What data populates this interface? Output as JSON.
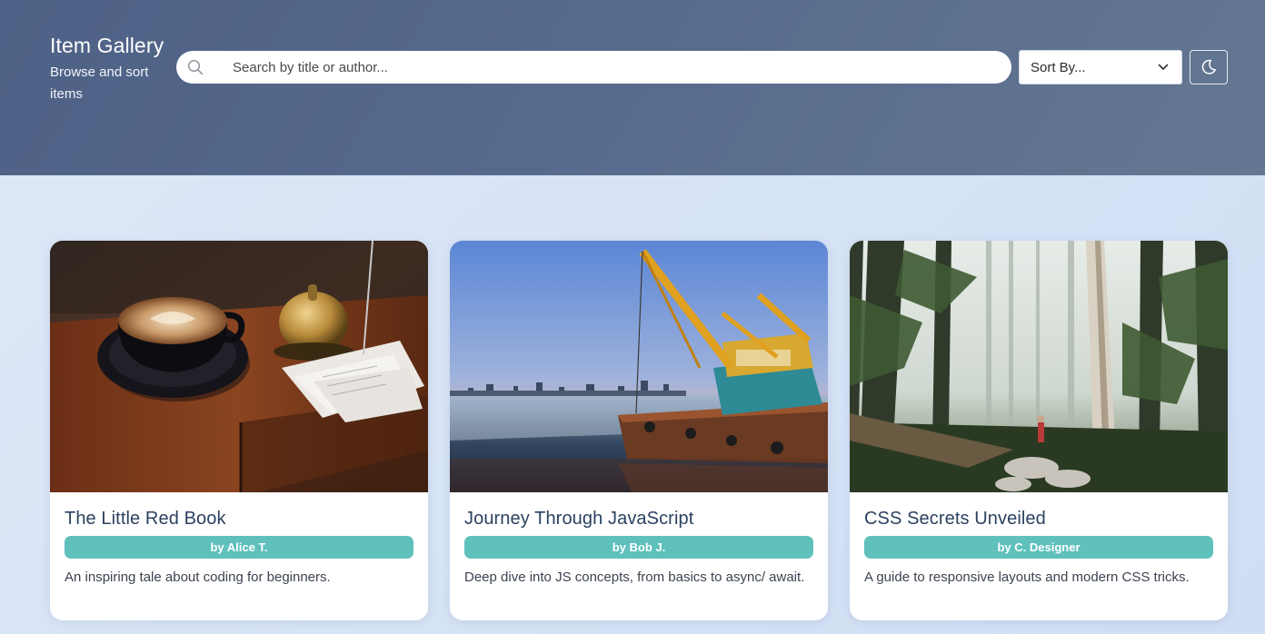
{
  "header": {
    "title": "Item Gallery",
    "subtitle": "Browse and sort items"
  },
  "search": {
    "placeholder": "Search by title or author...",
    "value": "",
    "icon": "search-icon"
  },
  "sort": {
    "selected": "Sort By...",
    "icon": "chevron-down-icon"
  },
  "theme_toggle": {
    "icon": "moon-icon"
  },
  "items": [
    {
      "title": "The Little Red Book",
      "author": "by Alice T.",
      "description": "An inspiring tale about coding for beginners.",
      "image": "coffee-cup-photo"
    },
    {
      "title": "Journey Through JavaScript",
      "author": "by Bob J.",
      "description": "Deep dive into JS concepts, from basics to async/ await.",
      "image": "harbor-crane-ship-photo"
    },
    {
      "title": "CSS Secrets Unveiled",
      "author": "by C. Designer",
      "description": "A guide to responsive layouts and modern CSS tricks.",
      "image": "misty-forest-photo"
    }
  ]
}
